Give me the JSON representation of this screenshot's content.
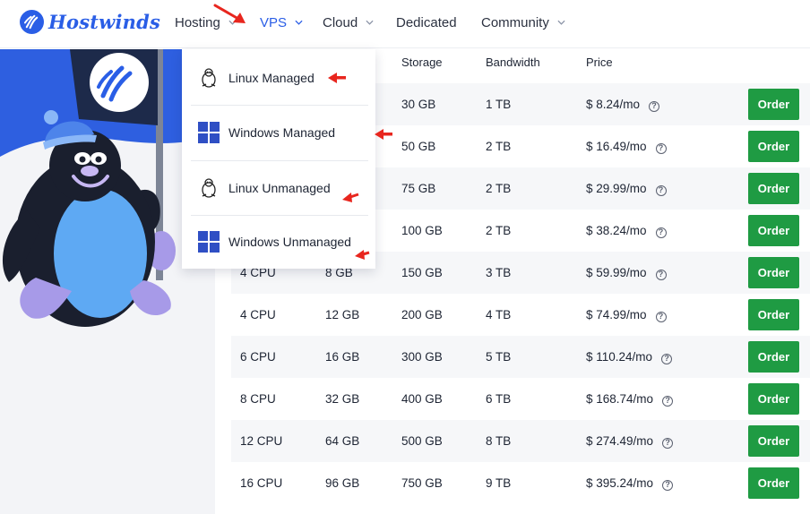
{
  "header": {
    "logo_text": "Hostwinds",
    "nav": [
      {
        "label": "Hosting"
      },
      {
        "label": "VPS"
      },
      {
        "label": "Cloud"
      },
      {
        "label": "Dedicated"
      },
      {
        "label": "Community"
      }
    ]
  },
  "dropdown": {
    "items": [
      {
        "label": "Linux Managed",
        "icon": "linux-penguin-icon"
      },
      {
        "label": "Windows Managed",
        "icon": "windows-logo-icon"
      },
      {
        "label": "Linux Unmanaged",
        "icon": "linux-penguin-icon"
      },
      {
        "label": "Windows Unmanaged",
        "icon": "windows-logo-icon"
      }
    ]
  },
  "table": {
    "headers": {
      "storage": "Storage",
      "bandwidth": "Bandwidth",
      "price": "Price"
    },
    "order_label": "Order",
    "rows": [
      {
        "cpu": "",
        "ram": "",
        "storage": "30 GB",
        "bandwidth": "1 TB",
        "price": "$ 8.24/mo"
      },
      {
        "cpu": "",
        "ram": "",
        "storage": "50 GB",
        "bandwidth": "2 TB",
        "price": "$ 16.49/mo"
      },
      {
        "cpu": "",
        "ram": "",
        "storage": "75 GB",
        "bandwidth": "2 TB",
        "price": "$ 29.99/mo"
      },
      {
        "cpu": "",
        "ram": "",
        "storage": "100 GB",
        "bandwidth": "2 TB",
        "price": "$ 38.24/mo"
      },
      {
        "cpu": "4 CPU",
        "ram": "8 GB",
        "storage": "150 GB",
        "bandwidth": "3 TB",
        "price": "$ 59.99/mo"
      },
      {
        "cpu": "4 CPU",
        "ram": "12 GB",
        "storage": "200 GB",
        "bandwidth": "4 TB",
        "price": "$ 74.99/mo"
      },
      {
        "cpu": "6 CPU",
        "ram": "16 GB",
        "storage": "300 GB",
        "bandwidth": "5 TB",
        "price": "$ 110.24/mo"
      },
      {
        "cpu": "8 CPU",
        "ram": "32 GB",
        "storage": "400 GB",
        "bandwidth": "6 TB",
        "price": "$ 168.74/mo"
      },
      {
        "cpu": "12 CPU",
        "ram": "64 GB",
        "storage": "500 GB",
        "bandwidth": "8 TB",
        "price": "$ 274.49/mo"
      },
      {
        "cpu": "16 CPU",
        "ram": "96 GB",
        "storage": "750 GB",
        "bandwidth": "9 TB",
        "price": "$ 395.24/mo"
      }
    ]
  },
  "colors": {
    "brand_blue": "#2a5ee6",
    "order_green": "#1f9b43",
    "annotation_red": "#e8261e"
  }
}
